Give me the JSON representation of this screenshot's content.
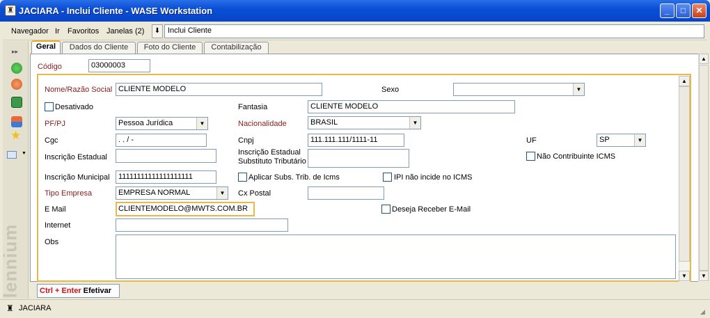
{
  "window": {
    "title": "JACIARA - Inclui Cliente - WASE Workstation"
  },
  "menu": {
    "items": [
      "Navegador",
      "Ir",
      "Favoritos",
      "Janelas (2)"
    ],
    "nav_value": "Inclui Cliente"
  },
  "tabs": [
    "Geral",
    "Dados do Cliente",
    "Foto do Cliente",
    "Contabilização"
  ],
  "form": {
    "codigo_label": "Código",
    "codigo": "03000003",
    "nome_label": "Nome/Razão Social",
    "nome": "CLIENTE MODELO",
    "sexo_label": "Sexo",
    "sexo": "",
    "desativado_label": "Desativado",
    "fantasia_label": "Fantasia",
    "fantasia": "CLIENTE MODELO",
    "pfpj_label": "PF/PJ",
    "pfpj": "Pessoa Jurídica",
    "nacionalidade_label": "Nacionalidade",
    "nacionalidade": "BRASIL",
    "cgc_label": "Cgc",
    "cgc": ".    .    /    -",
    "cnpj_label": "Cnpj",
    "cnpj": "111.111.111/1111-11",
    "uf_label": "UF",
    "uf": "SP",
    "ie_label": "Inscrição Estadual",
    "ie": "",
    "ie_st_label1": "Inscrição Estadual",
    "ie_st_label2": "Substituto Tributário",
    "ie_st": "",
    "nao_contrib_label": "Não Contribuinte ICMS",
    "im_label": "Inscrição Municipal",
    "im": "11111111111111111111",
    "aplicar_label": "Aplicar Subs. Trib. de Icms",
    "ipi_label": "IPI não incide no ICMS",
    "tipo_label": "Tipo Empresa",
    "tipo": "EMPRESA NORMAL",
    "cxpostal_label": "Cx Postal",
    "cxpostal": "",
    "email_label": "E Mail",
    "email": "CLIENTEMODELO@MWTS.COM.BR",
    "deseja_label": "Deseja Receber E-Mail",
    "internet_label": "Internet",
    "internet": "",
    "obs_label": "Obs",
    "obs": ""
  },
  "bottom": {
    "shortcut": "Ctrl + Enter",
    "action": "Efetivar"
  },
  "status": {
    "user": "JACIARA"
  },
  "brand": "Millennium"
}
